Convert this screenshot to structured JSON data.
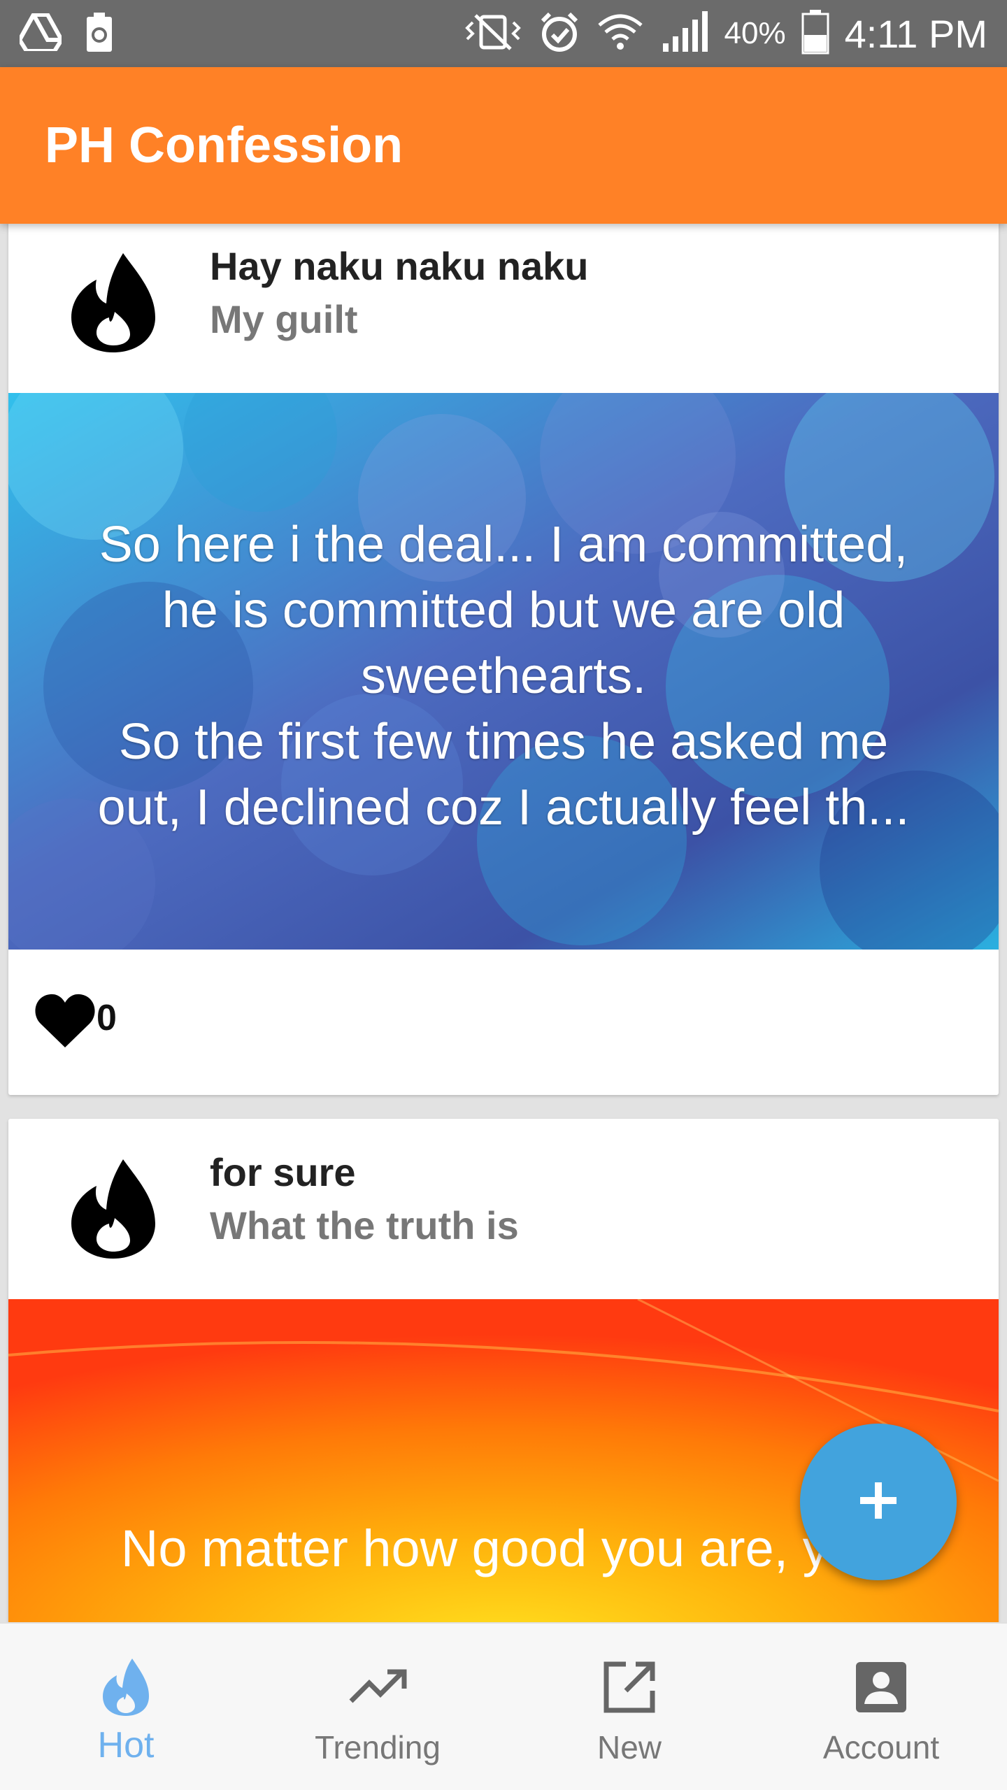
{
  "status_bar": {
    "battery_percent": "40%",
    "time": "4:11 PM",
    "icons": [
      "drive-icon",
      "recycle-icon",
      "vibrate-icon",
      "alarm-icon",
      "wifi-icon",
      "signal-icon",
      "battery-icon"
    ]
  },
  "app_bar": {
    "title": "PH Confession"
  },
  "posts": [
    {
      "title": "Hay naku naku naku",
      "subtitle": "My guilt",
      "body_lines": [
        "So here i the deal... I am committed,",
        "he is committed but we are old",
        "sweethearts.",
        "So the first few times he asked me",
        "out, I declined coz I actually feel th..."
      ],
      "likes": "0",
      "background_colors": [
        "#2ec2ea",
        "#4a63b0",
        "#2a3a86"
      ]
    },
    {
      "title": "for sure",
      "subtitle": "What the truth is",
      "body_lines": [
        "No matter how good you are, you"
      ],
      "background_colors": [
        "#ff3a10",
        "#ff8a10",
        "#ffd21a"
      ]
    }
  ],
  "fab": {
    "icon": "plus-icon",
    "color": "#42a3dd"
  },
  "bottom_nav": {
    "items": [
      {
        "label": "Hot",
        "icon": "flame-icon",
        "active": true
      },
      {
        "label": "Trending",
        "icon": "trending-up-icon",
        "active": false
      },
      {
        "label": "New",
        "icon": "open-in-new-icon",
        "active": false
      },
      {
        "label": "Account",
        "icon": "account-box-icon",
        "active": false
      }
    ]
  },
  "colors": {
    "accent": "#ff8126",
    "active_nav": "#6fb1ee"
  }
}
